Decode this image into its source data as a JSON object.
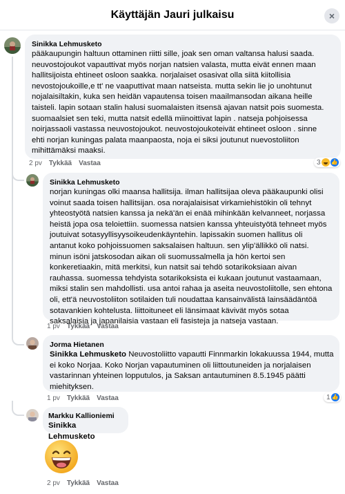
{
  "header": {
    "title": "Käyttäjän Jauri julkaisu",
    "close_label": "×"
  },
  "comments": [
    {
      "author": "Sinikka Lehmusketo",
      "lines": [
        "pääkaupungin haltuun ottaminen riitti sille, joak sen oman valtansa halusi saada.",
        "neuvostojoukot vapauttivat myös norjan natsien valasta, mutta eivät ennen maan",
        "hallitsijoista ehtineet osloon saakka. norjalaiset osasivat olla siitä kiitollisia",
        "nevostojoukoille,e tt' ne vaaputtivat maan natseista. mutta sekin lie jo unohtunut",
        "nojalaisiltakin, kuka sen heidän vapautensa toisen maailmansodan aikana heille",
        "taisteli. lapin sotaan stalin halusi suomalaisten itsensä ajavan natsit pois suomesta.",
        "suomaalsiet sen teki, mutta natsit edellä miinoittivat lapin . natseja pohjoisessa",
        "noirjassaoli vastassa neuvostojoukot. neuvostojoukoteivät ehtineet osloon . sinne",
        "ehti norjan kuningas palata maanpaosta, noja ei siksi joutunut nuevostoliiton",
        "mihittämäksi maaksi."
      ],
      "time": "2 pv",
      "like": "Tykkää",
      "reply": "Vastaa",
      "reaction_count": "3"
    },
    {
      "author": "Sinikka Lehmusketo",
      "lines": [
        "norjan kuningas olki maansa hallitsija. ilman hallitsijaa oleva pääkaupunki olisi",
        "voinut saada toisen hallitsijan. osa norajalaisisat virkamiehistökin oli tehnyt",
        "yhteostyötä natsien kanssa ja nekä'än ei enää mihinkään kelvanneet, norjassa",
        "heistä jopa osa teloiettiin. suomessa natsien kanssa yhteuistyötä tehneet myös",
        "joutuivat sotasyyllisyysoikeudenkäyntehin. lapissakin suomen hallitus oli",
        "antanut koko pohjoissuomen saksalaisen haltuun. sen ylip'ällikkö oli natsi.",
        "minun isöni jatskosodan aikan oli suomussalmella ja hön kertoi sen",
        "konkeretiaakin, mitä merkitsi, kun natsit sai tehdö sotarikoksiaan aivan",
        "rauhassa. suomessa tehdyista sotarikoksista ei kukaan joutunut vastaamaan,",
        "miksi stalin sen mahdollisti. usa antoi rahaa ja aseita neuvostoliitolle, sen ehtona",
        "oli, ett'ä neuvostoliiton sotilaiden tuli noudattaa kansainvälistä lainsäädäntöä",
        "sotavankien kohtelusta. liittoituneet eli länsimaat kävivät myös sotaa",
        "saksalaisia ja japanilaisia vastaan eli fasisteja ja natseja vastaan."
      ],
      "time": "1 pv",
      "like": "Tykkää",
      "reply": "Vastaa"
    },
    {
      "author": "Jorma Hietanen",
      "mention": "Sinikka Lehmusketo",
      "lines": [
        " Neuvostoliitto vapautti Finnmarkin lokakuussa 1944, mutta",
        "ei koko Norjaa. Koko Norjan vapautuminen oli liittoutuneiden ja norjalaisen",
        "vastarinnan yhteinen lopputulos, ja Saksan antautuminen 8.5.1945 päätti",
        "miehityksen."
      ],
      "time": "1 pv",
      "like": "Tykkää",
      "reply": "Vastaa",
      "reaction_count": "1"
    },
    {
      "author": "Markku Kallioniemi",
      "mention": "Sinikka Lehmusketo",
      "time": "2 pv",
      "like": "Tykkää",
      "reply": "Vastaa"
    }
  ],
  "icons": {
    "close": "close-icon",
    "like": "like-reaction-icon",
    "laugh": "laugh-reaction-icon",
    "sticker": "laughing-emoji-sticker"
  },
  "colors": {
    "bubble": "#f0f2f5",
    "meta_text": "#65676b",
    "like_blue": "#1877f2",
    "laugh_yellow": "#f7b928"
  }
}
